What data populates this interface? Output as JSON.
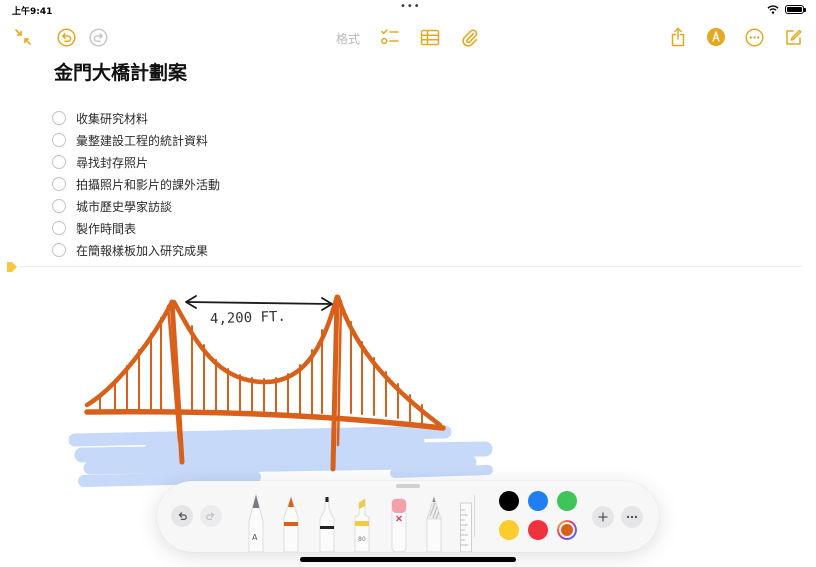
{
  "status": {
    "time": "上午9:41",
    "dots": "•••"
  },
  "toolbar": {
    "format_label": "格式"
  },
  "note": {
    "title": "金門大橋計劃案",
    "checklist": [
      "收集研究材料",
      "彙整建設工程的統計資料",
      "尋找封存照片",
      "拍攝照片和影片的課外活動",
      "城市歷史學家訪談",
      "製作時間表",
      "在簡報樣板加入研究成果"
    ]
  },
  "drawing": {
    "annotation": "4,200 FT."
  },
  "palette": {
    "tools": [
      "monoline-pen",
      "pen",
      "fineliner",
      "marker",
      "eraser",
      "pencil",
      "ruler"
    ],
    "marker_label": "80",
    "colors": [
      "#000000",
      "#1f7ef0",
      "#3fc45a",
      "#fccb2d",
      "#f0323f",
      "#d8601a"
    ],
    "selected_color": "#d8601a"
  },
  "colors": {
    "accent": "#e5a820",
    "bridge": "#d8601a",
    "water": "#6c9ef0"
  }
}
